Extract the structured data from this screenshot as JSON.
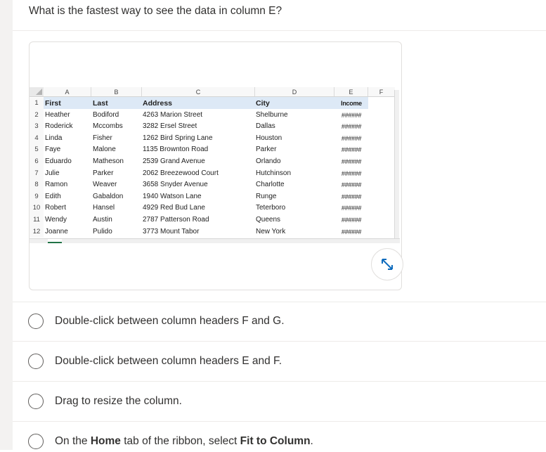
{
  "question": "What is the fastest way to see the data in column E?",
  "spreadsheet": {
    "columns": [
      "A",
      "B",
      "C",
      "D",
      "E",
      "F"
    ],
    "rows": [
      "1",
      "2",
      "3",
      "4",
      "5",
      "6",
      "7",
      "8",
      "9",
      "10",
      "11",
      "12"
    ],
    "header": [
      "First",
      "Last",
      "Address",
      "City",
      "Income"
    ],
    "data": [
      [
        "Heather",
        "Bodiford",
        "4263 Marion Street",
        "Shelburne",
        "######"
      ],
      [
        "Roderick",
        "Mccombs",
        "3282 Ersel Street",
        "Dallas",
        "######"
      ],
      [
        "Linda",
        "Fisher",
        "1262 Bird Spring Lane",
        "Houston",
        "######"
      ],
      [
        "Faye",
        "Malone",
        "1135 Brownton Road",
        "Parker",
        "######"
      ],
      [
        "Eduardo",
        "Matheson",
        "2539 Grand Avenue",
        "Orlando",
        "######"
      ],
      [
        "Julie",
        "Parker",
        "2062 Breezewood Court",
        "Hutchinson",
        "######"
      ],
      [
        "Ramon",
        "Weaver",
        "3658 Snyder Avenue",
        "Charlotte",
        "######"
      ],
      [
        "Edith",
        "Gabaldon",
        "1940 Watson Lane",
        "Runge",
        "######"
      ],
      [
        "Robert",
        "Hansel",
        "4929 Red Bud Lane",
        "Teterboro",
        "######"
      ],
      [
        "Wendy",
        "Austin",
        "2787 Patterson Road",
        "Queens",
        "######"
      ],
      [
        "Joanne",
        "Pulido",
        "3773 Mount Tabor",
        "New York",
        "######"
      ]
    ]
  },
  "expand_icon": "expand-arrows-icon",
  "answers": [
    {
      "text": "Double-click between column headers F and G."
    },
    {
      "text": "Double-click between column headers E and F."
    },
    {
      "text": "Drag to resize the column."
    },
    {
      "pre": "On the ",
      "bold1": "Home",
      "mid": " tab of the ribbon, select ",
      "bold2": "Fit to Column",
      "post": "."
    }
  ],
  "colors": {
    "accent": "#0f6cbd",
    "header_band": "#dde9f6",
    "sheet_tab": "#217346"
  }
}
